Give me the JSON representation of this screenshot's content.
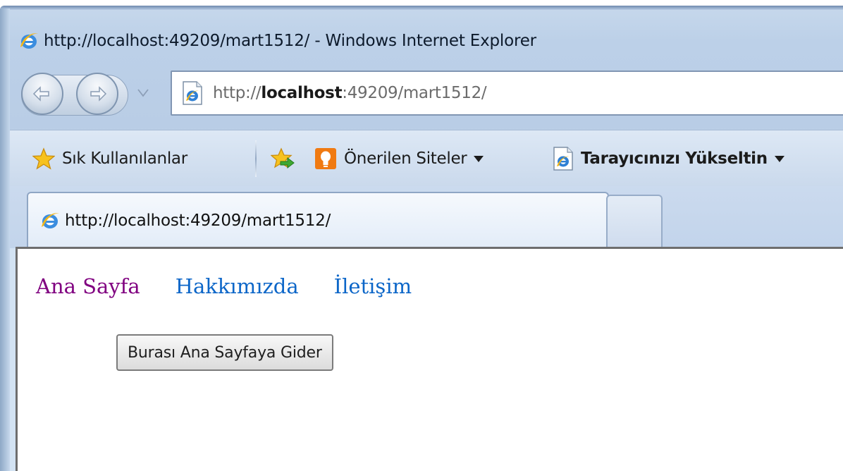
{
  "window": {
    "title": "http://localhost:49209/mart1512/ - Windows Internet Explorer"
  },
  "address_bar": {
    "prefix": "http://",
    "host": "localhost",
    "suffix": ":49209/mart1512/"
  },
  "favorites_bar": {
    "favorites_label": "Sık Kullanılanlar",
    "suggested_sites_label": "Önerilen Siteler",
    "upgrade_browser_label": "Tarayıcınızı Yükseltin"
  },
  "tabs": [
    {
      "label": "http://localhost:49209/mart1512/",
      "active": true
    }
  ],
  "page": {
    "nav_links": [
      "Ana Sayfa",
      "Hakkımızda",
      "İletişim"
    ],
    "button_label": "Burası Ana Sayfaya Gider"
  },
  "colors": {
    "visited_link": "#800080",
    "link": "#0c66c8"
  }
}
